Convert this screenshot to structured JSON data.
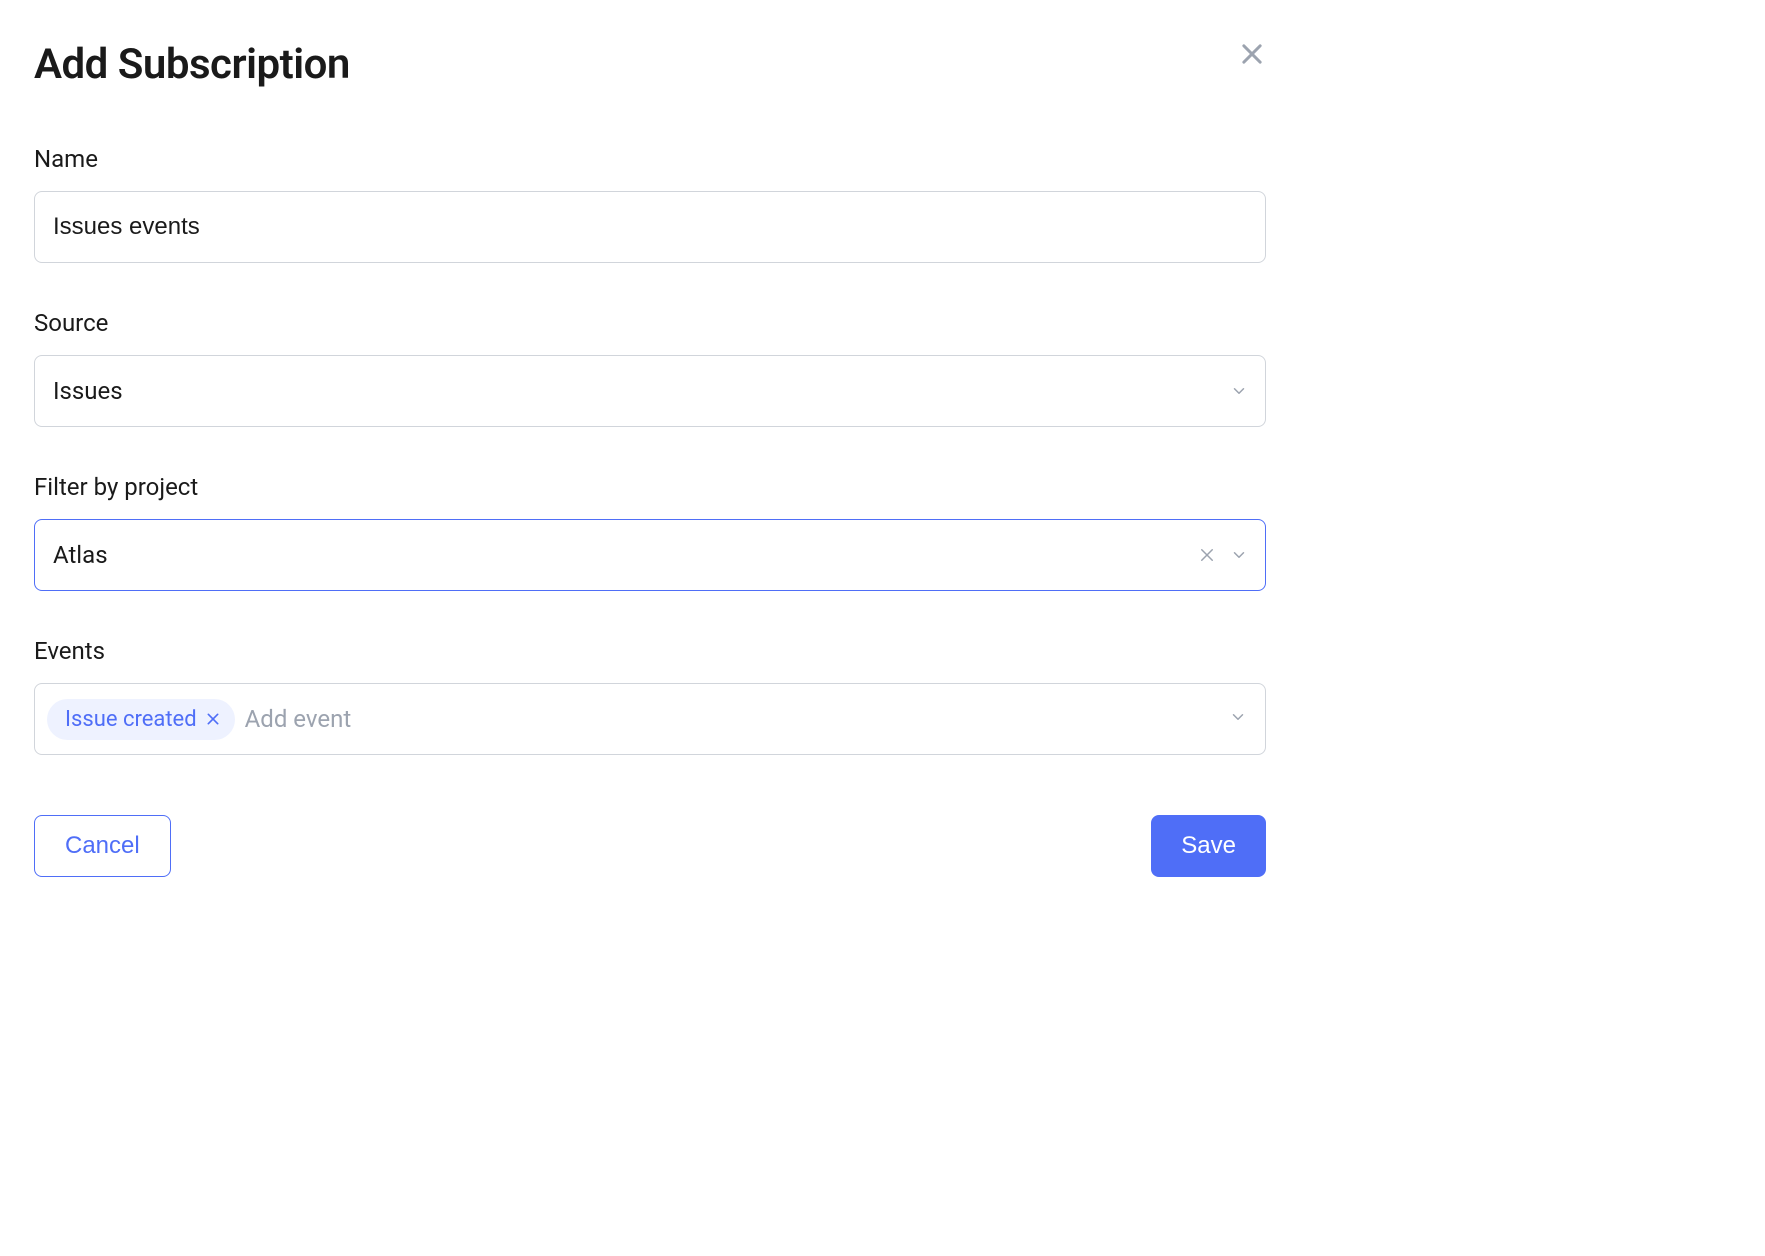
{
  "header": {
    "title": "Add Subscription"
  },
  "form": {
    "name": {
      "label": "Name",
      "value": "Issues events"
    },
    "source": {
      "label": "Source",
      "value": "Issues"
    },
    "filter_by_project": {
      "label": "Filter by project",
      "value": "Atlas"
    },
    "events": {
      "label": "Events",
      "tags": [
        {
          "label": "Issue created"
        }
      ],
      "placeholder": "Add event"
    }
  },
  "footer": {
    "cancel_label": "Cancel",
    "save_label": "Save"
  },
  "colors": {
    "accent": "#4f6ef7",
    "tag_bg": "#eef2ff",
    "border": "#d1d5db",
    "muted": "#9ca3af"
  }
}
